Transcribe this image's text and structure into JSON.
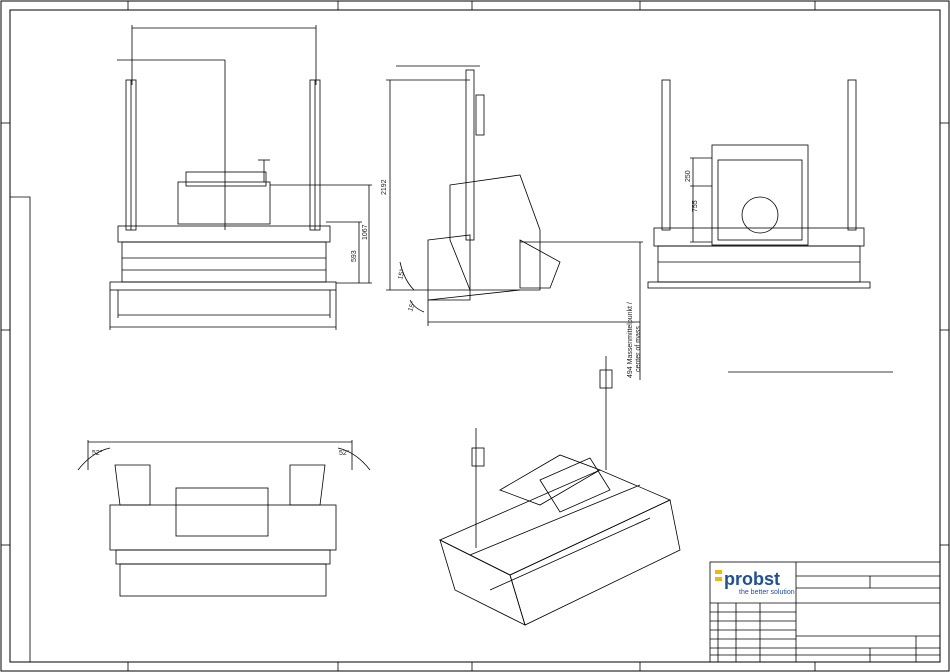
{
  "drawing": {
    "front_view": {
      "dim_height_total": "1067",
      "dim_height_lower": "593"
    },
    "side_view": {
      "dim_height": "2192",
      "angle_top": "15°",
      "angle_bottom": "15°",
      "center_of_mass_label_de": "494 Massenmittelpunkt /",
      "center_of_mass_label_en": "center of mass"
    },
    "rear_view": {
      "dim_upper": "250",
      "dim_lower": "755"
    },
    "top_view": {
      "angle_left": "52°",
      "angle_right": "52°"
    }
  },
  "title_block": {
    "brand": "probst",
    "slogan": "the better solution",
    "brand_color": "#1d4f9c",
    "accent_color": "#f5b800"
  }
}
